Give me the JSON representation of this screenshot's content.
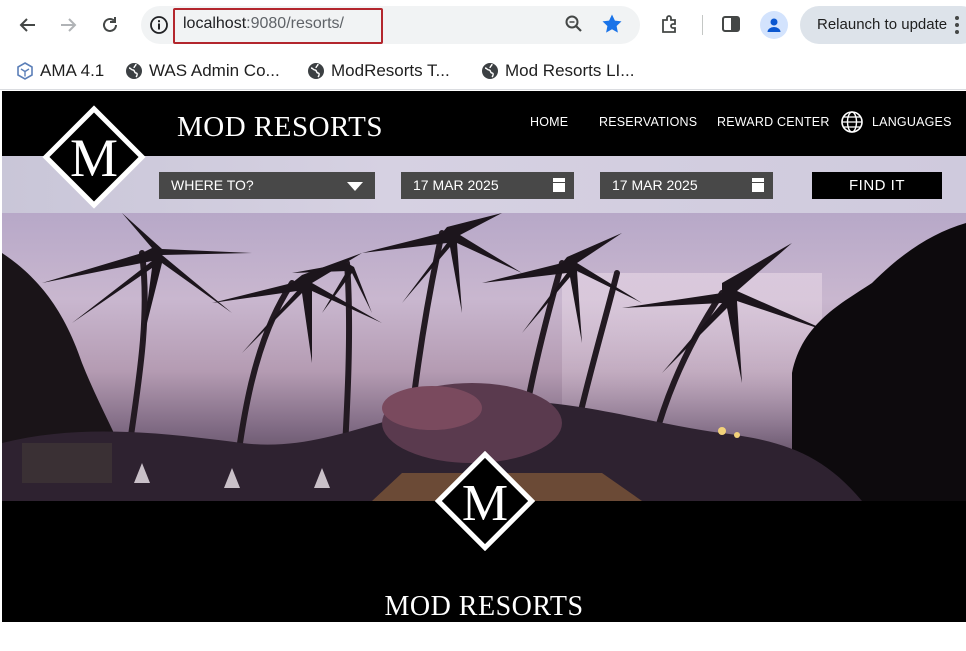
{
  "browser": {
    "url_host": "localhost",
    "url_path": ":9080/resorts/",
    "relaunch_label": "Relaunch to update",
    "bookmarks": [
      {
        "label": "AMA 4.1",
        "icon": "ama-icon"
      },
      {
        "label": "WAS Admin Co...",
        "icon": "globe-icon"
      },
      {
        "label": "ModResorts T...",
        "icon": "globe-icon"
      },
      {
        "label": "Mod Resorts LI...",
        "icon": "globe-icon"
      }
    ],
    "accent_color": "#1a73e8",
    "highlight_color": "#b3262d"
  },
  "site": {
    "logo_letter": "M",
    "brand_name": "MOD RESORTS",
    "nav": {
      "home": "HOME",
      "reservations": "RESERVATIONS",
      "reward_center": "REWARD CENTER",
      "languages": "LANGUAGES"
    },
    "search": {
      "destination": "WHERE TO?",
      "checkin": "17 MAR 2025",
      "checkout": "17 MAR 2025",
      "find_label": "FIND IT"
    },
    "footer_brand": "MOD RESORTS"
  }
}
